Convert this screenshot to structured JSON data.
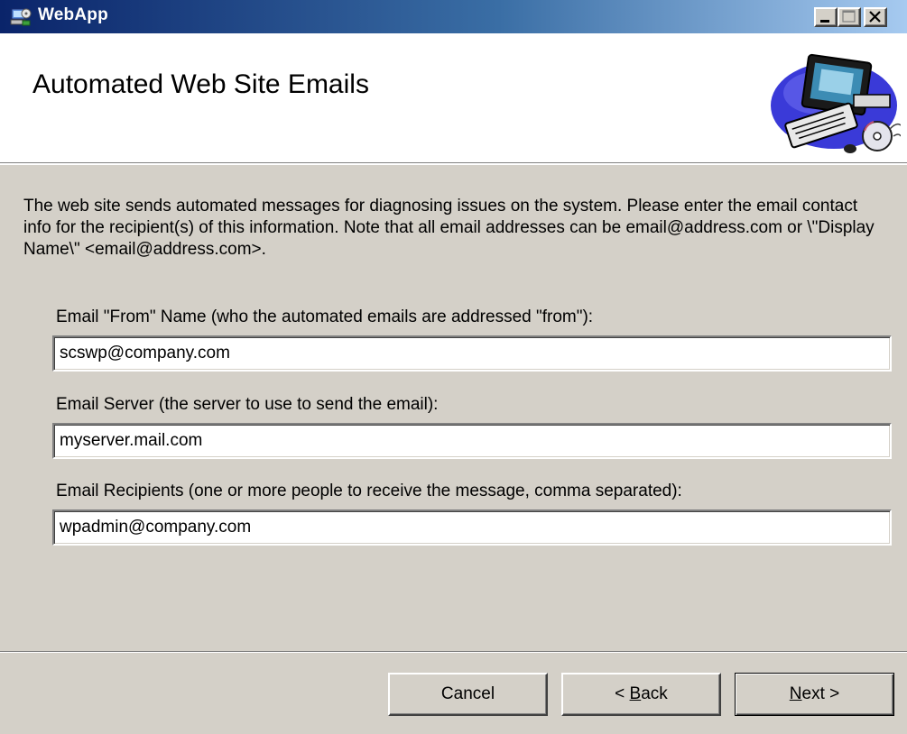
{
  "window": {
    "title": "WebApp",
    "icon": "installer-app-icon",
    "controls": [
      "minimize-icon",
      "maximize-icon",
      "close-icon"
    ]
  },
  "header": {
    "title": "Automated Web Site Emails",
    "graphic": "computer-with-cd-graphic"
  },
  "description": "The web site sends automated messages for diagnosing issues on the system.  Please enter the email contact info for the recipient(s) of this information.  Note that all email addresses can be email@address.com or \\\"Display Name\\\" <email@address.com>.",
  "fields": [
    {
      "label": "Email \"From\" Name (who the automated emails are addressed \"from\"):",
      "value": "scswp@company.com"
    },
    {
      "label": "Email Server (the server to use to send the email):",
      "value": "myserver.mail.com"
    },
    {
      "label": "Email Recipients (one or more people to receive the message, comma separated):",
      "value": "wpadmin@company.com"
    }
  ],
  "buttons": {
    "cancel": "Cancel",
    "back_prefix": "< ",
    "back_mnemonic": "B",
    "back_rest": "ack",
    "next_mnemonic": "N",
    "next_rest": "ext >"
  },
  "colors": {
    "titlebar_start": "#0a246a",
    "titlebar_end": "#a6caf0",
    "face": "#d4d0c8"
  }
}
